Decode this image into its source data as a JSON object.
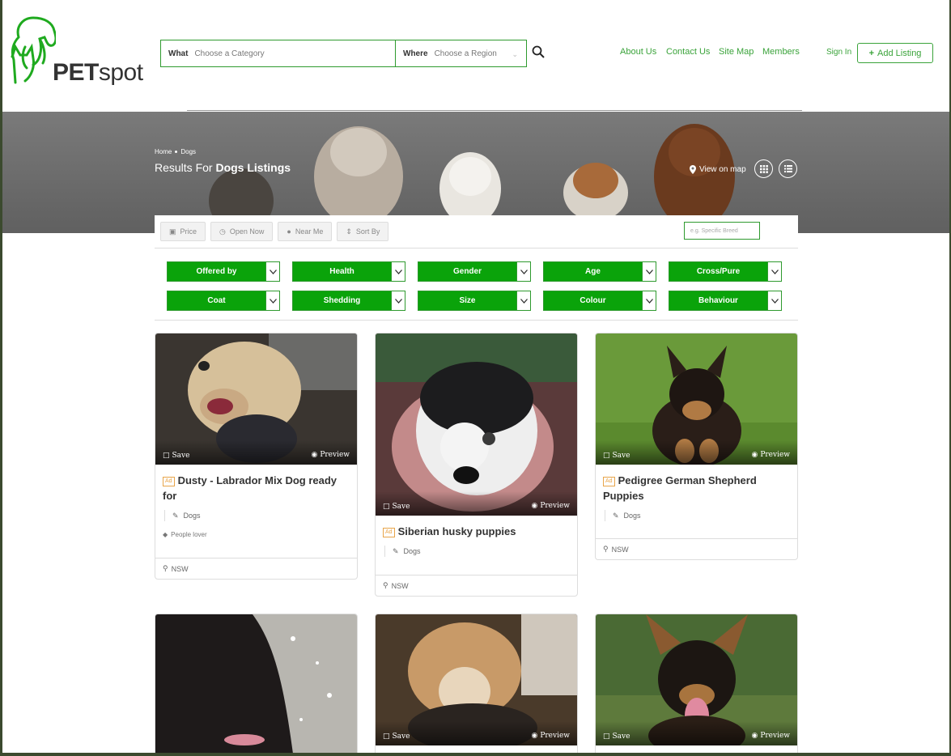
{
  "colors": {
    "brand_green": "#0aa30a",
    "link_green": "#3aa33a",
    "ad_orange": "#e8a54a"
  },
  "header": {
    "logo": {
      "text_bold": "PET",
      "text_light": "spot"
    },
    "search": {
      "what_label": "What",
      "what_placeholder": "Choose a Category",
      "where_label": "Where",
      "where_placeholder": "Choose a Region",
      "search_icon": "magnifier-icon"
    },
    "nav": [
      "About Us",
      "Contact Us",
      "Site Map",
      "Members"
    ],
    "sign_in": "Sign In",
    "add_listing": "Add Listing"
  },
  "hero": {
    "breadcrumb": [
      "Home",
      "Dogs"
    ],
    "results_prefix": "Results For",
    "results_bold": "Dogs Listings",
    "view_on_map": "View on map"
  },
  "filters": {
    "quick": [
      "Price",
      "Open Now",
      "Near Me",
      "Sort By"
    ],
    "breed_placeholder": "e.g. Specific Breed",
    "dropdowns": [
      "Offered by",
      "Health",
      "Gender",
      "Age",
      "Cross/Pure",
      "Coat",
      "Shedding",
      "Size",
      "Colour",
      "Behaviour"
    ]
  },
  "card_labels": {
    "save": "Save",
    "preview": "Preview",
    "ad": "Ad"
  },
  "listings": [
    {
      "title": "Dusty - Labrador Mix Dog ready for",
      "category": "Dogs",
      "tag": "People lover",
      "location": "NSW"
    },
    {
      "title": "Siberian husky puppies",
      "category": "Dogs",
      "location": "NSW"
    },
    {
      "title": "Pedigree German Shepherd Puppies",
      "category": "Dogs",
      "location": "NSW"
    }
  ]
}
